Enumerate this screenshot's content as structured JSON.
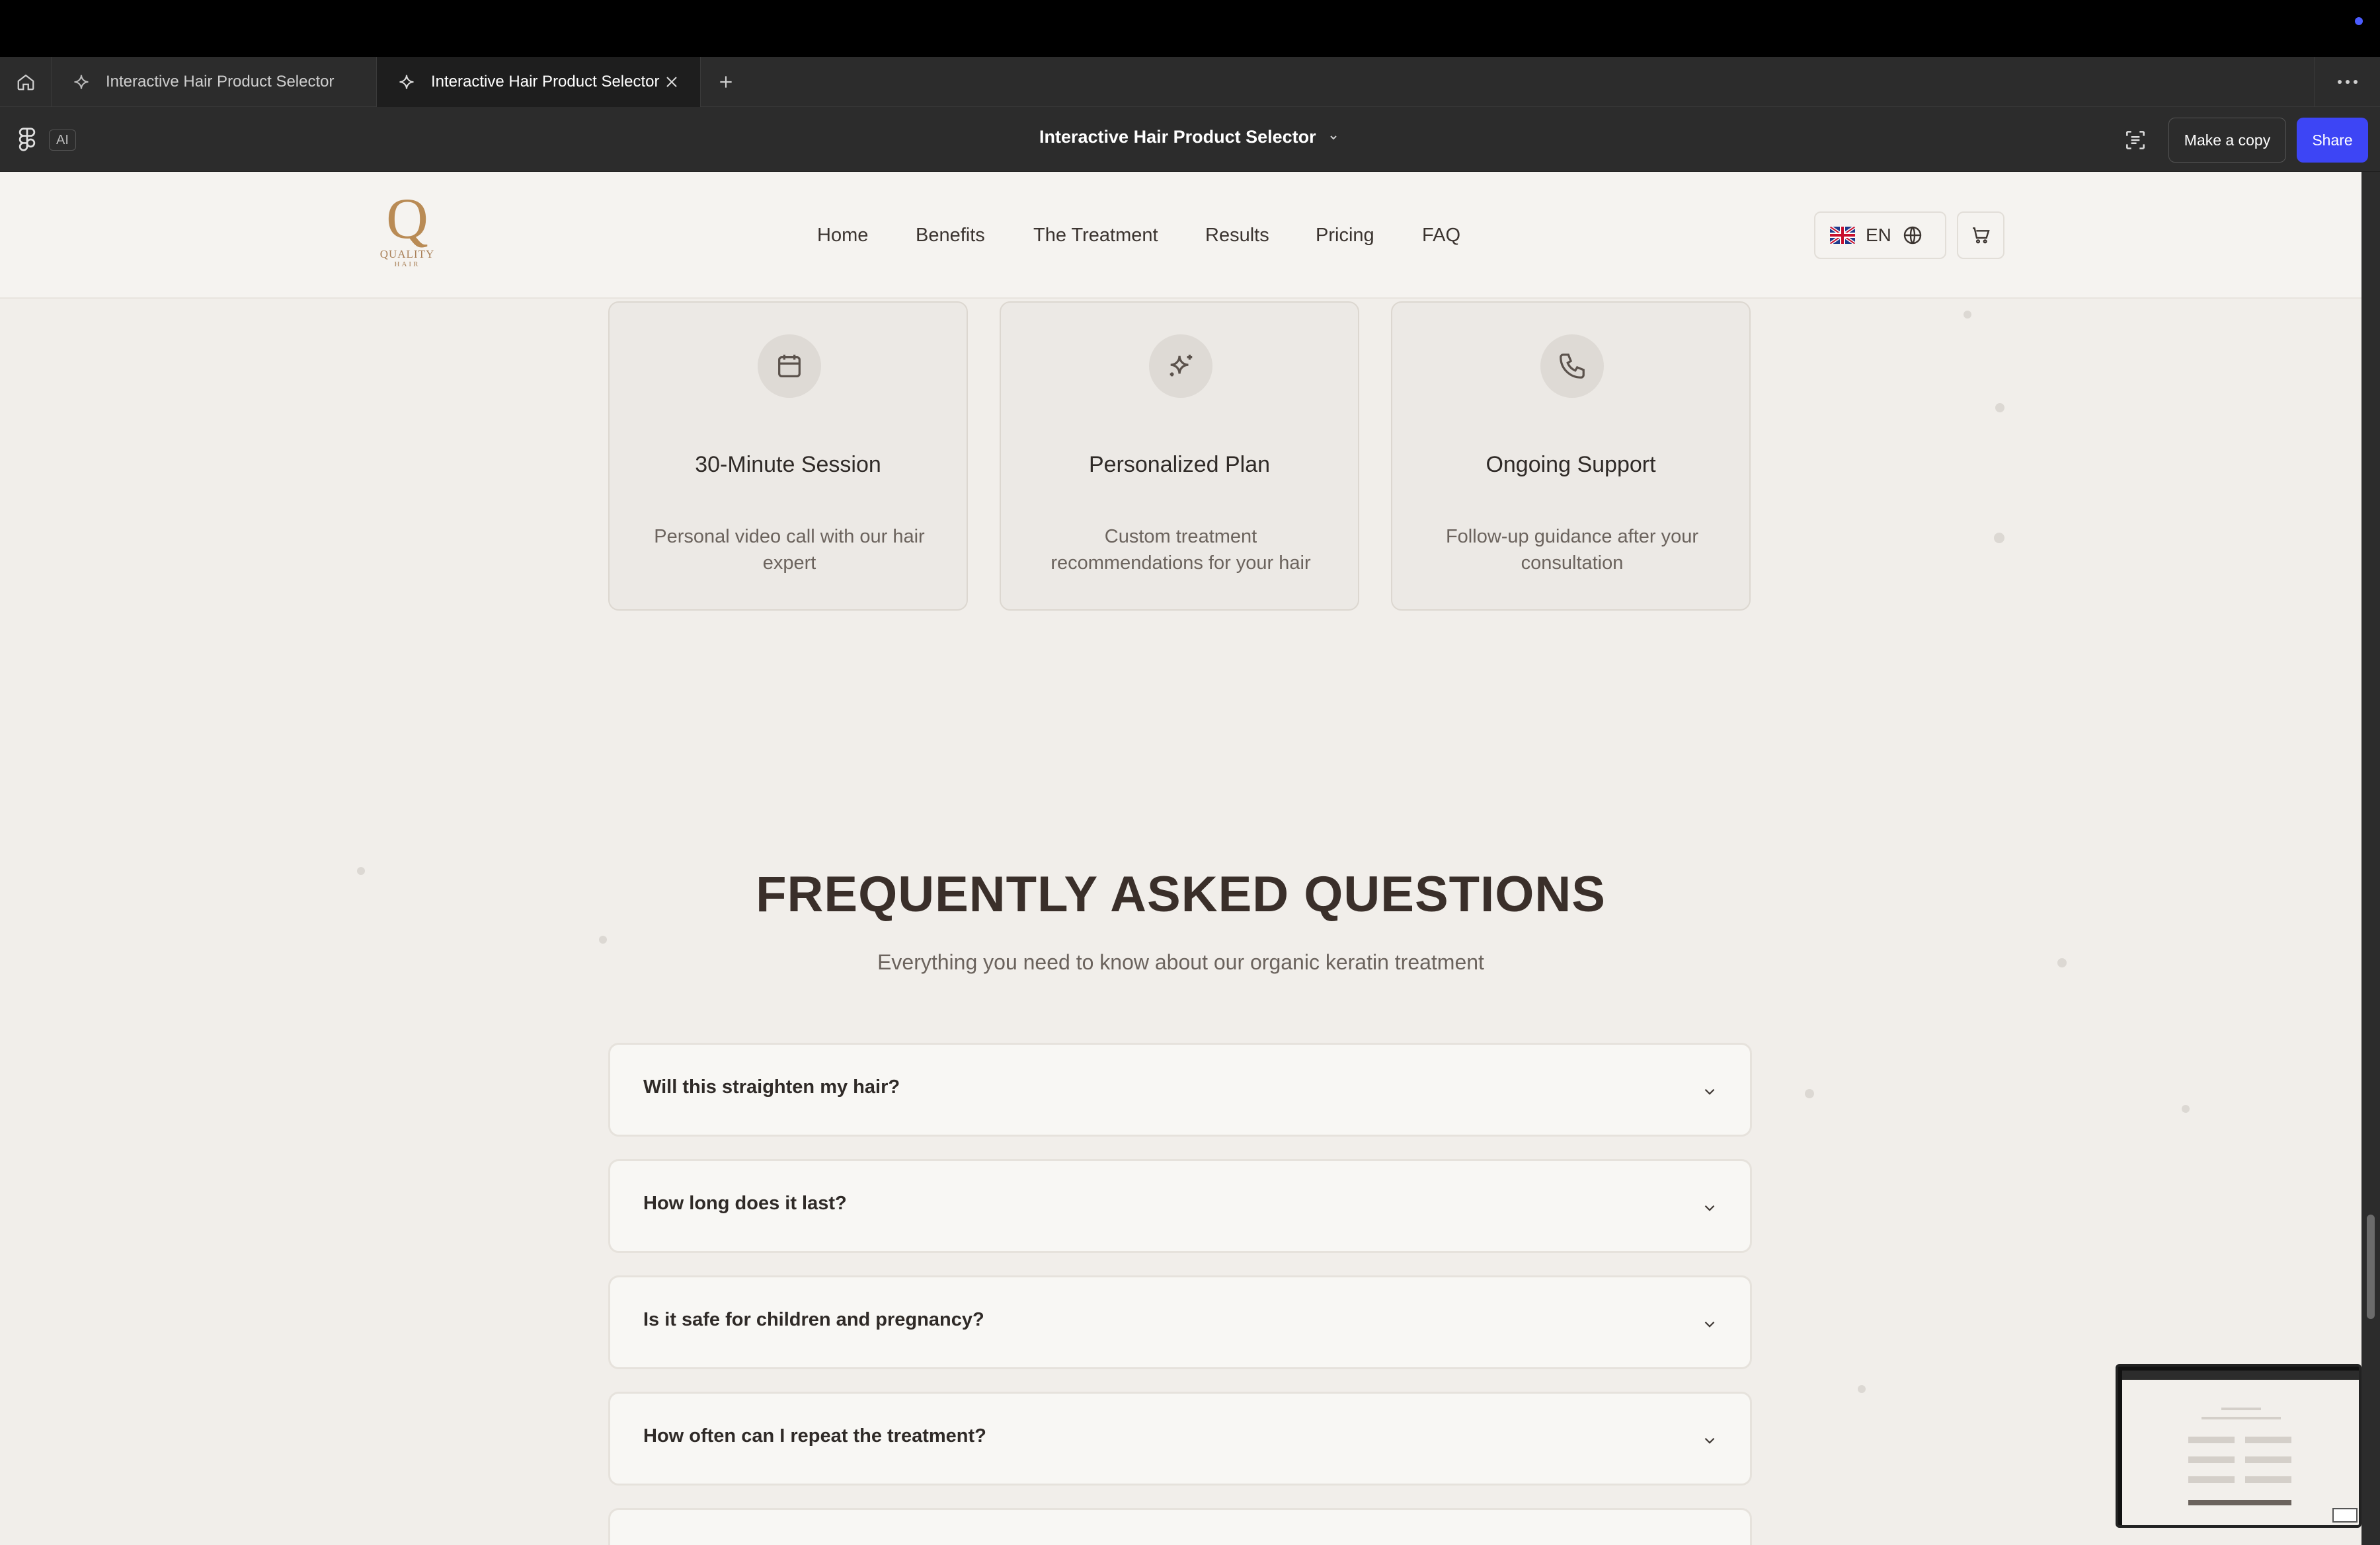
{
  "browser": {
    "tabs": [
      {
        "label": "Interactive Hair Product Selector",
        "active": false
      },
      {
        "label": "Interactive Hair Product Selector",
        "active": true
      }
    ]
  },
  "toolbar": {
    "ai_label": "AI",
    "file_title": "Interactive Hair Product Selector",
    "copy_label": "Make a copy",
    "share_label": "Share",
    "accent": "#3d45f5"
  },
  "site": {
    "logo": {
      "letter": "Q",
      "line1": "QUALITY",
      "line2": "HAIR"
    },
    "nav": [
      "Home",
      "Benefits",
      "The Treatment",
      "Results",
      "Pricing",
      "FAQ"
    ],
    "language": "EN"
  },
  "features": [
    {
      "icon": "calendar-icon",
      "title": "30-Minute Session",
      "description": "Personal video call with our hair expert"
    },
    {
      "icon": "sparkles-icon",
      "title": "Personalized Plan",
      "description": "Custom treatment recommendations for your hair"
    },
    {
      "icon": "phone-icon",
      "title": "Ongoing Support",
      "description": "Follow-up guidance after your consultation"
    }
  ],
  "faq": {
    "title": "FREQUENTLY ASKED QUESTIONS",
    "subtitle": "Everything you need to know about our organic keratin treatment",
    "items": [
      "Will this straighten my hair?",
      "How long does it last?",
      "Is it safe for children and pregnancy?",
      "How often can I repeat the treatment?"
    ]
  }
}
